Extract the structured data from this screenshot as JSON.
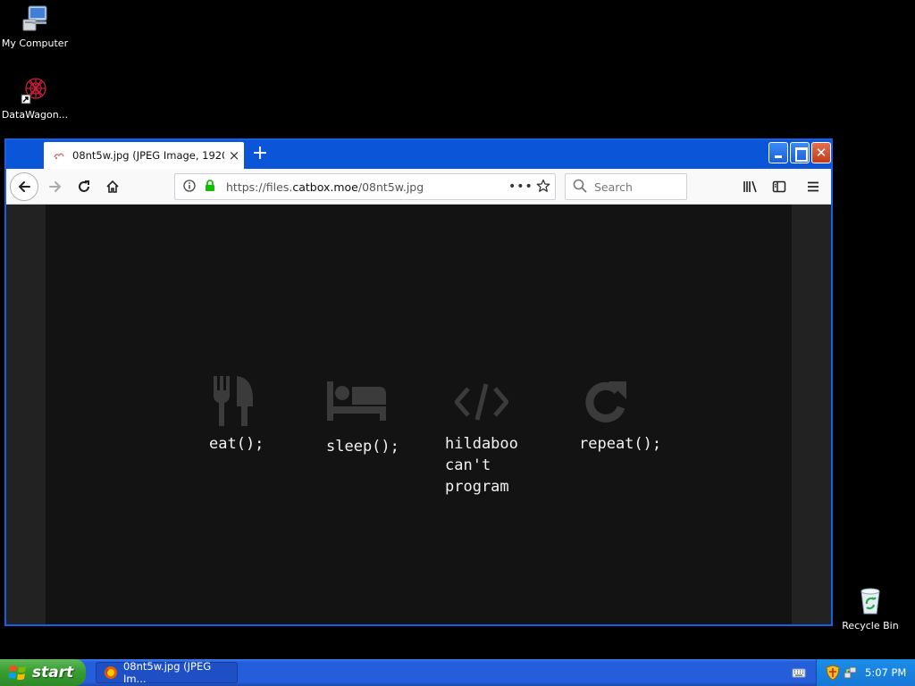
{
  "desktop": {
    "icons": [
      {
        "label": "My Computer",
        "icon": "computer-icon"
      },
      {
        "label": "DataWagon...",
        "icon": "datawagon-shortcut-icon"
      },
      {
        "label": "Recycle Bin",
        "icon": "recycle-bin-icon"
      }
    ]
  },
  "browser": {
    "tab": {
      "title": "08nt5w.jpg (JPEG Image, 1920",
      "close": "×"
    },
    "new_tab": "+",
    "url": {
      "prefix": "https://files.",
      "domain": "catbox.moe",
      "path": "/08nt5w.jpg"
    },
    "url_more": "•••",
    "search_placeholder": "Search"
  },
  "image": {
    "steps": [
      {
        "icon": "fork-knife-icon",
        "text": "eat();"
      },
      {
        "icon": "bed-icon",
        "text": "sleep();"
      },
      {
        "icon": "code-icon",
        "lines": [
          "hildaboo",
          "can't",
          "program"
        ]
      },
      {
        "icon": "repeat-icon",
        "text": "repeat();"
      }
    ]
  },
  "taskbar": {
    "start_label": "start",
    "task_label": "08nt5w.jpg (JPEG Im...",
    "clock": "5:07 PM"
  },
  "colors": {
    "xp_blue": "#245edb",
    "start_green": "#379e30",
    "image_bg": "#131313",
    "icon_gray": "#3b3b3b"
  }
}
